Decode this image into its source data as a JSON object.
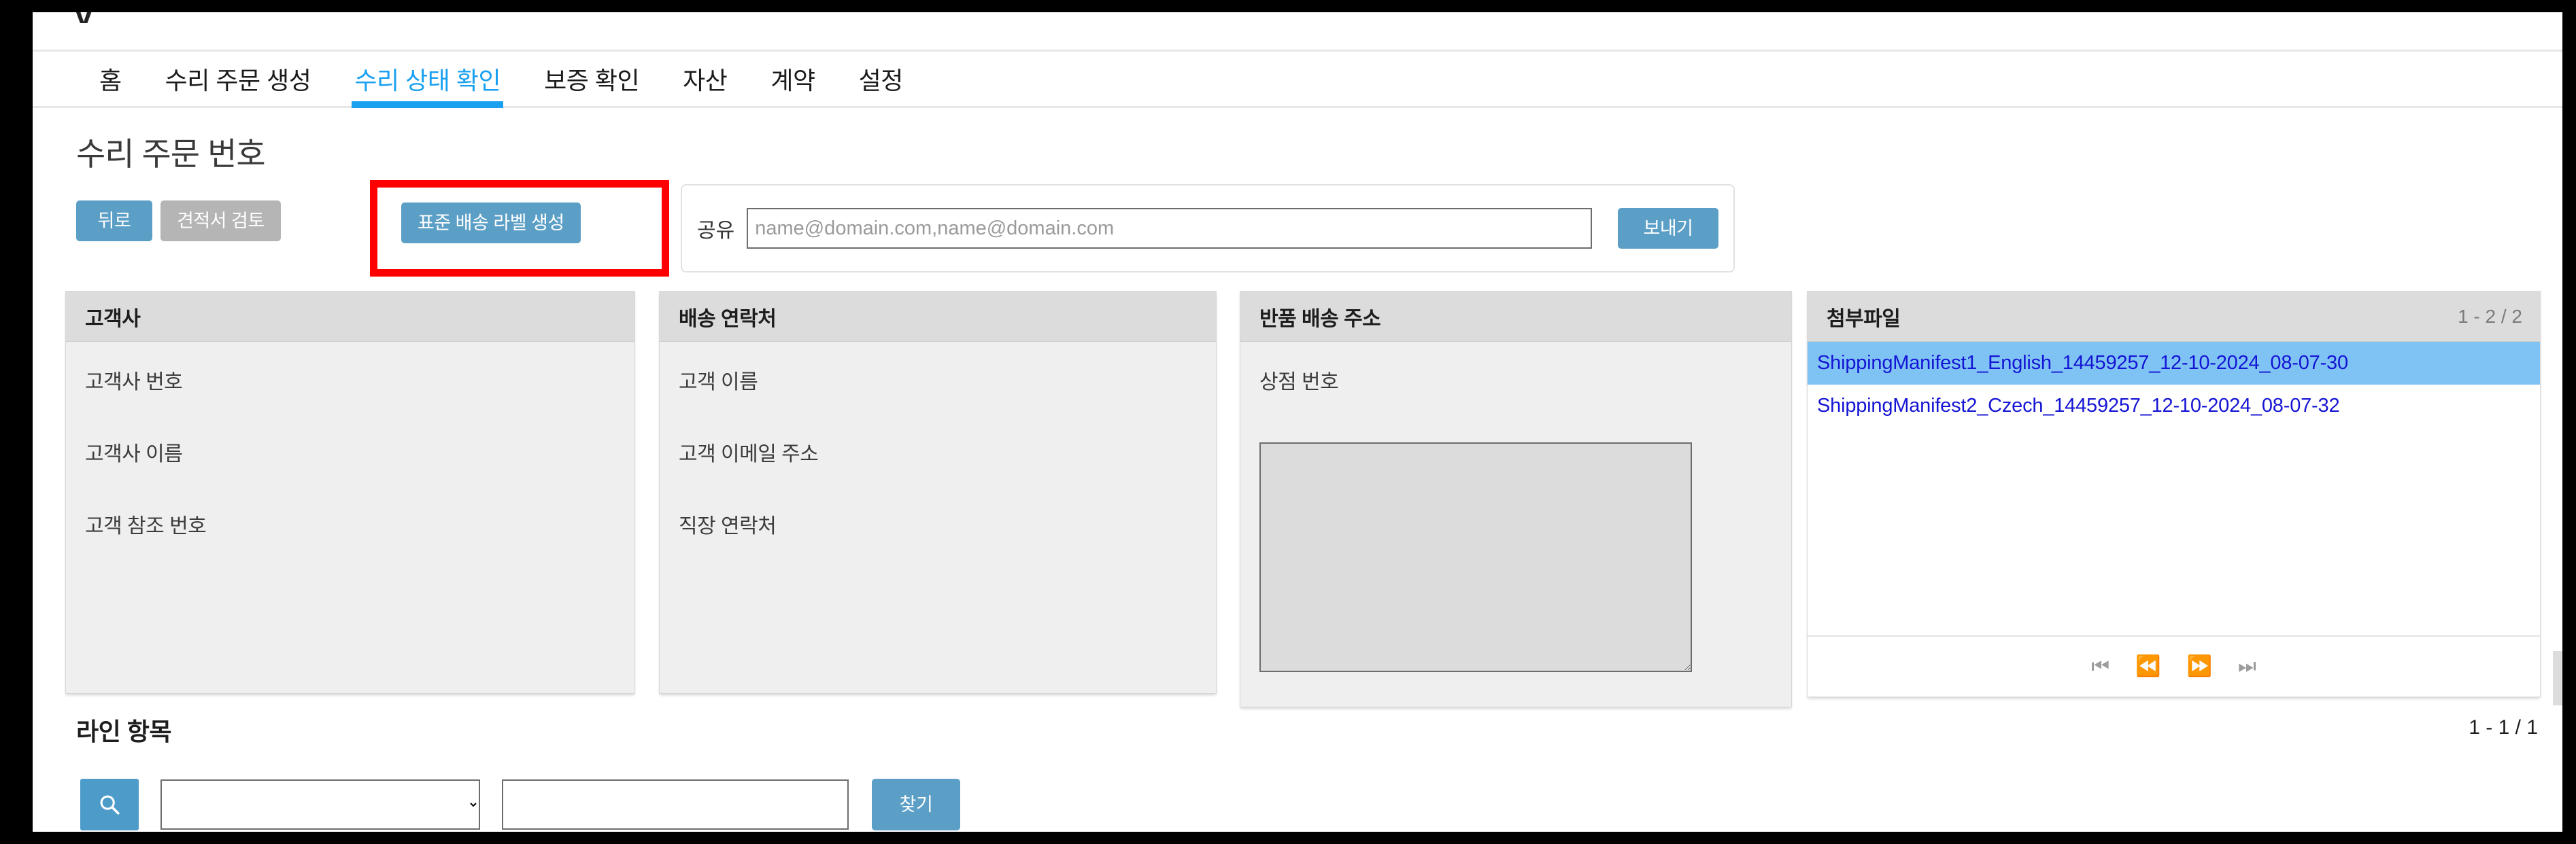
{
  "top_sliver_glyph": "ᐯ",
  "nav": {
    "items": [
      {
        "label": "홈",
        "active": false
      },
      {
        "label": "수리 주문 생성",
        "active": false
      },
      {
        "label": "수리 상태 확인",
        "active": true
      },
      {
        "label": "보증 확인",
        "active": false
      },
      {
        "label": "자산",
        "active": false
      },
      {
        "label": "계약",
        "active": false
      },
      {
        "label": "설정",
        "active": false
      }
    ]
  },
  "page": {
    "title": "수리 주문 번호"
  },
  "toolbar": {
    "back_label": "뒤로",
    "review_quote_label": "견적서 검토",
    "create_label": "표준 배송 라벨 생성",
    "highlight_color": "#fe0000",
    "primary_color": "#5c9fc6",
    "disabled_color": "#b5b5b5"
  },
  "share": {
    "label": "공유",
    "placeholder": "name@domain.com,name@domain.com",
    "value": "",
    "send_label": "보내기"
  },
  "panels": [
    {
      "title": "고객사",
      "fields": [
        "고객사 번호",
        "고객사 이름",
        "고객 참조 번호"
      ]
    },
    {
      "title": "배송 연락처",
      "fields": [
        "고객 이름",
        "고객 이메일 주소",
        "직장 연락처"
      ]
    },
    {
      "title": "반품 배송 주소",
      "fields": [
        "상점 번호"
      ],
      "textarea_value": ""
    }
  ],
  "attachments": {
    "title": "첨부파일",
    "count_label": "1 - 2 / 2",
    "items": [
      {
        "name": "ShippingManifest1_English_14459257_12-10-2024_08-07-30",
        "selected": true
      },
      {
        "name": "ShippingManifest2_Czech_14459257_12-10-2024_08-07-32",
        "selected": false
      }
    ],
    "pager": [
      {
        "icon": "⏮",
        "name": "first-page"
      },
      {
        "icon": "⏪",
        "name": "prev-page"
      },
      {
        "icon": "⏩",
        "name": "next-page"
      },
      {
        "icon": "⏭",
        "name": "last-page"
      }
    ]
  },
  "line_items": {
    "title": "라인 항목",
    "count_label": "1 - 1 / 1",
    "search_icon": "search-icon",
    "filter_value": "",
    "filter_options": [
      ""
    ],
    "query_value": "",
    "find_label": "찾기"
  }
}
